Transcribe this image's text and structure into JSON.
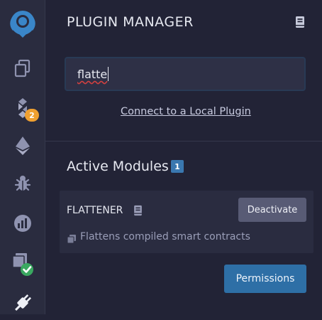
{
  "icon_bar": {
    "items": [
      {
        "icon": "remix-logo-icon"
      },
      {
        "icon": "file-explorer-icon"
      },
      {
        "icon": "solidity-compiler-icon",
        "badge": "2"
      },
      {
        "icon": "deploy-run-icon"
      },
      {
        "icon": "debugger-icon"
      },
      {
        "icon": "analysis-icon"
      },
      {
        "icon": "testing-icon"
      },
      {
        "icon": "plugin-manager-icon"
      }
    ]
  },
  "header": {
    "title": "PLUGIN MANAGER",
    "doc_icon": "book-icon"
  },
  "search": {
    "value": "flatte"
  },
  "local_plugin_link": "Connect to a Local Plugin",
  "active_modules": {
    "title": "Active Modules",
    "count": "1",
    "plugins": [
      {
        "name": "FLATTENER",
        "doc_icon": "book-icon",
        "action_label": "Deactivate",
        "description": "Flattens compiled smart contracts"
      }
    ]
  },
  "permissions_label": "Permissions",
  "colors": {
    "background": "#222336",
    "sidebar": "#2a2c3f",
    "accent": "#2e6fa6",
    "badge_warning": "#f0a030",
    "logo": "#3a86c8",
    "check": "#3aa860"
  }
}
